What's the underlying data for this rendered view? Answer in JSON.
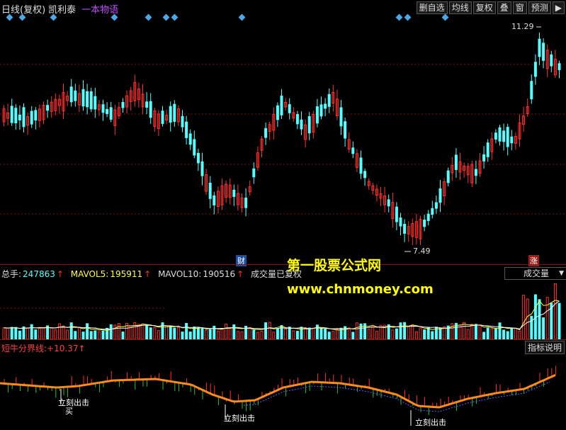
{
  "header": {
    "period": "日线(复权)",
    "stock_name": "凯利泰",
    "concept": "一本物语",
    "buttons": [
      "删自选",
      "均线",
      "复权",
      "叠",
      "窗",
      "预测"
    ]
  },
  "price_chart": {
    "high_label": "11.29",
    "low_label": "7.49",
    "tag_cai": "财",
    "tag_zhang": "涨"
  },
  "volume_panel": {
    "total_label": "总手:",
    "total_value": "247863",
    "mavol5_label": "MAVOL5:",
    "mavol5_value": "195911",
    "mavol10_label": "MAVOL10:",
    "mavol10_value": "190516",
    "note": "成交量已复权",
    "dropdown": "成交量"
  },
  "indicator_panel": {
    "label": "短牛分界线:",
    "value": "+10.37",
    "help_button": "指标说明",
    "signal_1": "立刻出击",
    "signal_2": "立刻出击",
    "signal_3": "立刻出击",
    "buy": "买"
  },
  "watermark": {
    "line1": "第一股票公式网",
    "line2": "www.chnmoney.com"
  },
  "colors": {
    "up": "#ff3030",
    "down": "#54ffff",
    "ma_line": "#ff8c1a",
    "accent": "#4aa8e8"
  }
}
